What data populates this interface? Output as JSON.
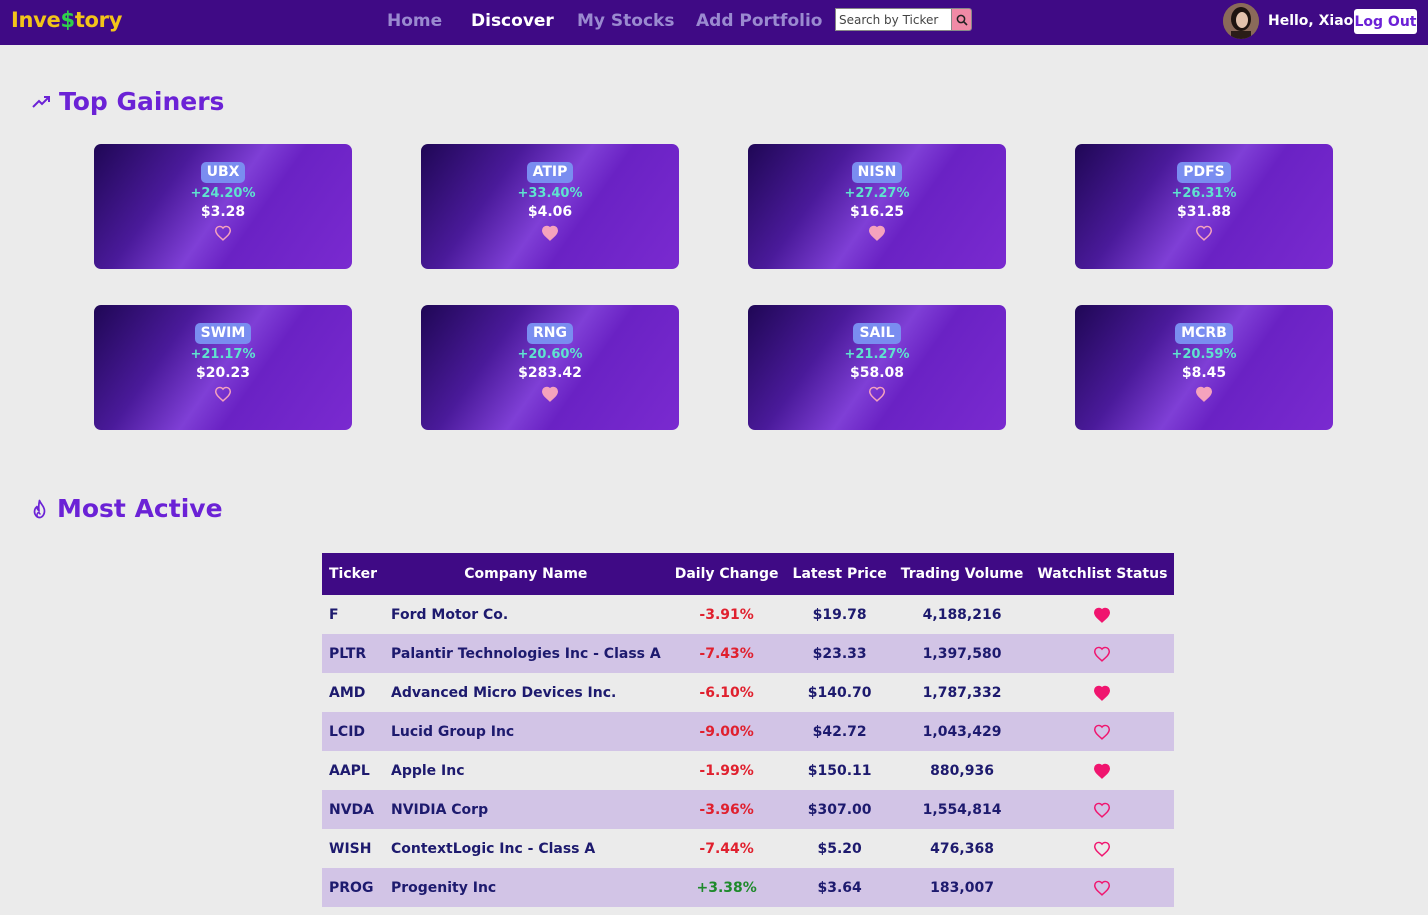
{
  "nav": {
    "logo_prefix": "Inve",
    "logo_dollar": "$",
    "logo_suffix": "tory",
    "links": [
      "Home",
      "Discover",
      "My Stocks",
      "Add Portfolio"
    ],
    "active": "Discover",
    "search_placeholder": "Search by Ticker",
    "greeting": "Hello, Xiao",
    "logout_label": "Log Out"
  },
  "top_gainers": {
    "title": "Top Gainers",
    "cards": [
      {
        "ticker": "UBX",
        "change": "+24.20%",
        "price": "$3.28",
        "watchlisted": false
      },
      {
        "ticker": "ATIP",
        "change": "+33.40%",
        "price": "$4.06",
        "watchlisted": true
      },
      {
        "ticker": "NISN",
        "change": "+27.27%",
        "price": "$16.25",
        "watchlisted": true
      },
      {
        "ticker": "PDFS",
        "change": "+26.31%",
        "price": "$31.88",
        "watchlisted": false
      },
      {
        "ticker": "SWIM",
        "change": "+21.17%",
        "price": "$20.23",
        "watchlisted": false
      },
      {
        "ticker": "RNG",
        "change": "+20.60%",
        "price": "$283.42",
        "watchlisted": true
      },
      {
        "ticker": "SAIL",
        "change": "+21.27%",
        "price": "$58.08",
        "watchlisted": false
      },
      {
        "ticker": "MCRB",
        "change": "+20.59%",
        "price": "$8.45",
        "watchlisted": true
      }
    ]
  },
  "most_active": {
    "title": "Most Active",
    "columns": [
      "Ticker",
      "Company Name",
      "Daily Change",
      "Latest Price",
      "Trading Volume",
      "Watchlist Status"
    ],
    "rows": [
      {
        "ticker": "F",
        "company": "Ford Motor Co.",
        "change": "-3.91%",
        "price": "$19.78",
        "volume": "4,188,216",
        "watchlisted": true
      },
      {
        "ticker": "PLTR",
        "company": "Palantir Technologies Inc - Class A",
        "change": "-7.43%",
        "price": "$23.33",
        "volume": "1,397,580",
        "watchlisted": false
      },
      {
        "ticker": "AMD",
        "company": "Advanced Micro Devices Inc.",
        "change": "-6.10%",
        "price": "$140.70",
        "volume": "1,787,332",
        "watchlisted": true
      },
      {
        "ticker": "LCID",
        "company": "Lucid Group Inc",
        "change": "-9.00%",
        "price": "$42.72",
        "volume": "1,043,429",
        "watchlisted": false
      },
      {
        "ticker": "AAPL",
        "company": "Apple Inc",
        "change": "-1.99%",
        "price": "$150.11",
        "volume": "880,936",
        "watchlisted": true
      },
      {
        "ticker": "NVDA",
        "company": "NVIDIA Corp",
        "change": "-3.96%",
        "price": "$307.00",
        "volume": "1,554,814",
        "watchlisted": false
      },
      {
        "ticker": "WISH",
        "company": "ContextLogic Inc - Class A",
        "change": "-7.44%",
        "price": "$5.20",
        "volume": "476,368",
        "watchlisted": false
      },
      {
        "ticker": "PROG",
        "company": "Progenity Inc",
        "change": "+3.38%",
        "price": "$3.64",
        "volume": "183,007",
        "watchlisted": false
      }
    ]
  },
  "icons": {
    "trend": "trending-up-icon",
    "fire": "fire-icon",
    "search": "search-icon",
    "heart": "heart-icon"
  },
  "colors": {
    "nav_bg": "#3f0a85",
    "accent": "#6b22d6",
    "logo_yellow": "#f2c419",
    "logo_green": "#2fd14a",
    "gain": "#5fe3cf",
    "loss": "#e0202e",
    "positive": "#1f8a2c",
    "card_heart": "#f5a3bd",
    "table_heart": "#f0156f"
  }
}
